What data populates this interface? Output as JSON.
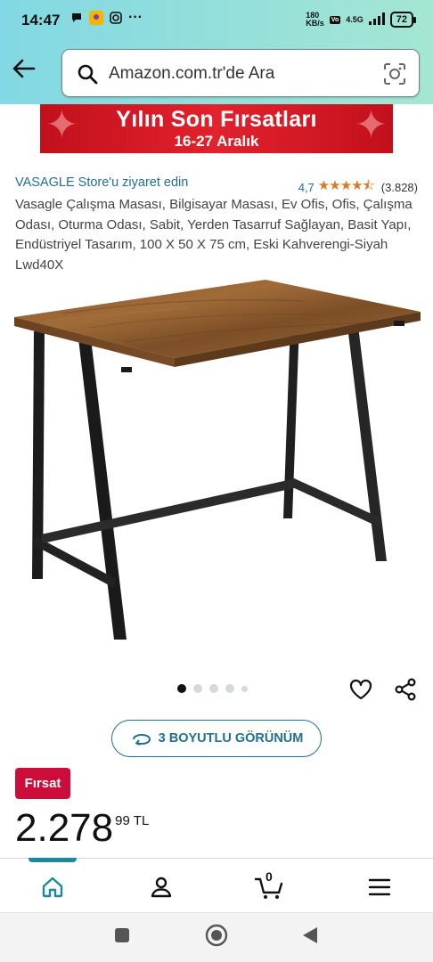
{
  "status_bar": {
    "time": "14:47",
    "net_speed": "180\nKB/s",
    "network": "4.5G",
    "battery": "72"
  },
  "search": {
    "placeholder": "Amazon.com.tr'de Ara"
  },
  "banner": {
    "title": "Yılın Son Fırsatları",
    "subtitle": "16-27 Aralık"
  },
  "product": {
    "store_link": "VASAGLE Store'u ziyaret edin",
    "rating_value": "4,7",
    "rating_count": "(3.828)",
    "title": "Vasagle Çalışma Masası, Bilgisayar Masası, Ev Ofis, Ofis, Çalışma Odası, Oturma Odası, Sabit, Yerden Tasarruf Sağlayan, Basit Yapı, Endüstriyel Tasarım, 100 X 50 X 75 cm, Eski Kahverengi-Siyah Lwd40X",
    "image_count": 5,
    "active_image": 0,
    "view_3d_label": "3 BOYUTLU GÖRÜNÜM",
    "deal_badge": "Fırsat",
    "price_whole": "2.278",
    "price_fraction": "99",
    "currency": "TL"
  },
  "bottom_nav": {
    "cart_count": "0",
    "active": "home"
  },
  "colors": {
    "header_gradient_start": "#82d8e3",
    "header_gradient_end": "#a5e6d3",
    "link": "#1f6f94",
    "deal": "#cc0c39",
    "star": "#de7921",
    "nav_active": "#1a8a9a"
  },
  "icons": [
    "back-arrow-icon",
    "search-icon",
    "camera-lens-icon",
    "heart-icon",
    "share-icon",
    "rotate-3d-icon",
    "home-icon",
    "user-icon",
    "cart-icon",
    "menu-icon"
  ]
}
